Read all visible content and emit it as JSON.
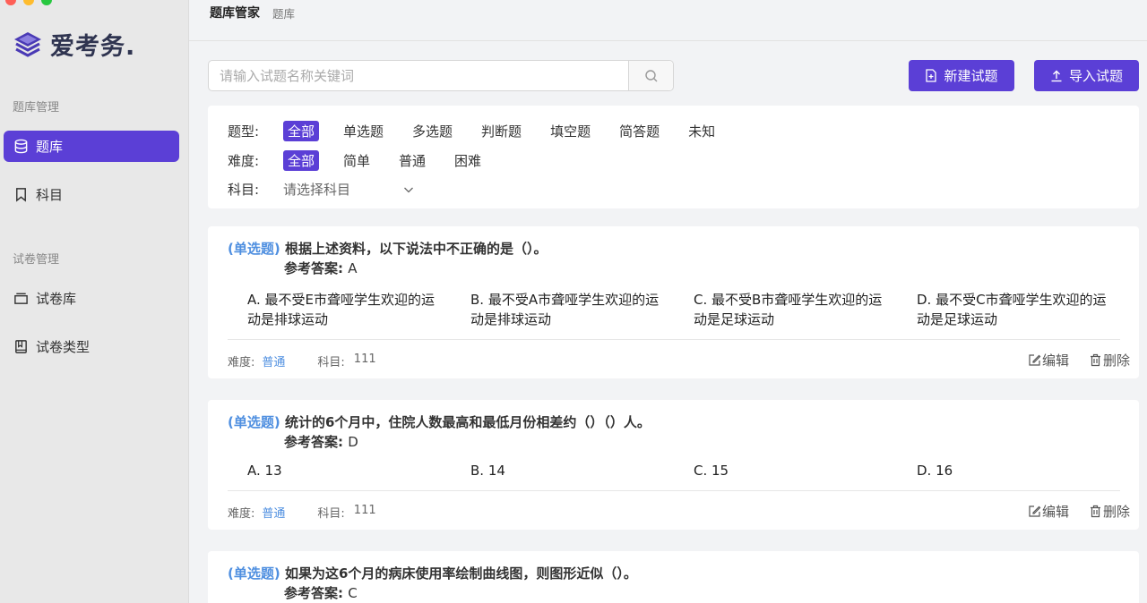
{
  "app": {
    "logo_text": "爱考务.",
    "colors": {
      "accent": "#5b3fd6",
      "link": "#4f8fe0"
    }
  },
  "sidebar": {
    "sections": [
      {
        "label": "题库管理",
        "items": [
          {
            "label": "题库",
            "icon": "database-icon",
            "active": true
          },
          {
            "label": "科目",
            "icon": "bookmark-icon",
            "active": false
          }
        ]
      },
      {
        "label": "试卷管理",
        "items": [
          {
            "label": "试卷库",
            "icon": "layers-icon",
            "active": false
          },
          {
            "label": "试卷类型",
            "icon": "book-icon",
            "active": false
          }
        ]
      }
    ]
  },
  "header": {
    "title": "题库管家",
    "breadcrumb": "题库"
  },
  "search": {
    "placeholder": "请输入试题名称关键词",
    "value": ""
  },
  "toolbar": {
    "new_label": "新建试题",
    "import_label": "导入试题"
  },
  "filters": {
    "type_label": "题型:",
    "types": [
      "全部",
      "单选题",
      "多选题",
      "判断题",
      "填空题",
      "简答题",
      "未知"
    ],
    "difficulty_label": "难度:",
    "difficulties": [
      "全部",
      "简单",
      "普通",
      "困难"
    ],
    "subject_label": "科目:",
    "subject_placeholder": "请选择科目"
  },
  "questions": [
    {
      "type": "(单选题)",
      "title": "根据上述资料，以下说法中不正确的是（）。",
      "answer_label": "参考答案:",
      "answer": "A",
      "options": [
        "A. 最不受E市聋哑学生欢迎的运动是排球运动",
        "B. 最不受A市聋哑学生欢迎的运动是排球运动",
        "C. 最不受B市聋哑学生欢迎的运动是足球运动",
        "D. 最不受C市聋哑学生欢迎的运动是足球运动"
      ],
      "difficulty_label": "难度:",
      "difficulty": "普通",
      "subject_label": "科目:",
      "subject": "111",
      "edit_label": "编辑",
      "delete_label": "删除"
    },
    {
      "type": "(单选题)",
      "title": "统计的6个月中，住院人数最高和最低月份相差约（）（）人。",
      "answer_label": "参考答案:",
      "answer": "D",
      "options": [
        "A. 13",
        "B. 14",
        "C. 15",
        "D. 16"
      ],
      "difficulty_label": "难度:",
      "difficulty": "普通",
      "subject_label": "科目:",
      "subject": "111",
      "edit_label": "编辑",
      "delete_label": "删除"
    },
    {
      "type": "(单选题)",
      "title": "如果为这6个月的病床使用率绘制曲线图，则图形近似（）。",
      "answer_label": "参考答案:",
      "answer": "C"
    }
  ]
}
